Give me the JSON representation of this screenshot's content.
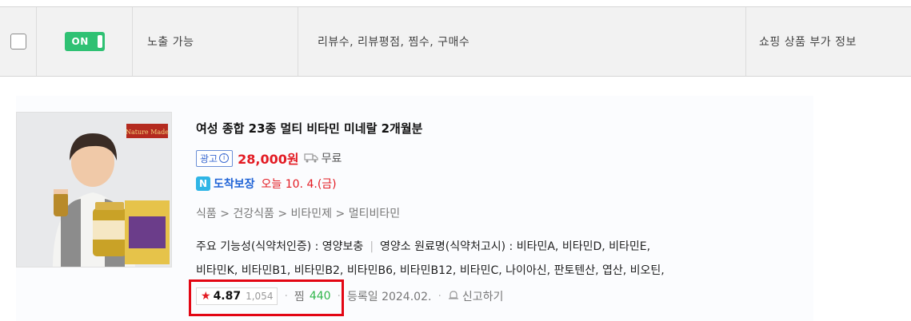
{
  "table": {
    "toggle_label": "ON",
    "expose_status": "노출 가능",
    "metrics_label": "리뷰수, 리뷰평점, 찜수, 구매수",
    "extra_label": "쇼핑 상품 부가 정보"
  },
  "product": {
    "title": "여성 종합 23종 멀티 비타민 미네랄 2개월분",
    "ad_label": "광고",
    "price": "28,000원",
    "shipping": "무료",
    "arrival_badge": "N",
    "arrival_label": "도착보장",
    "arrival_date": "오늘 10. 4.(금)",
    "category": "식품 > 건강식품 > 비타민제 > 멀티비타민",
    "spec_function": "주요 기능성(식약처인증) : 영양보충",
    "spec_ingredients": "영양소 원료명(식약처고시) : 비타민A, 비타민D, 비타민E,",
    "spec_ingredients_2": "비타민K, 비타민B1, 비타민B2, 비타민B6, 비타민B12, 비타민C, 나이아신, 판토텐산, 엽산, 비오틴,",
    "rating": "4.87",
    "review_count": "1,054",
    "wish_label": "찜",
    "wish_count": "440",
    "registered": "등록일 2024.02.",
    "report_label": "신고하기",
    "brand_text": "Nature Made"
  },
  "colors": {
    "toggle_on": "#2fc173",
    "price_red": "#e31b23",
    "highlight_red": "#e30613",
    "wish_green": "#2fb54a",
    "arrival_blue": "#1f63d6"
  }
}
